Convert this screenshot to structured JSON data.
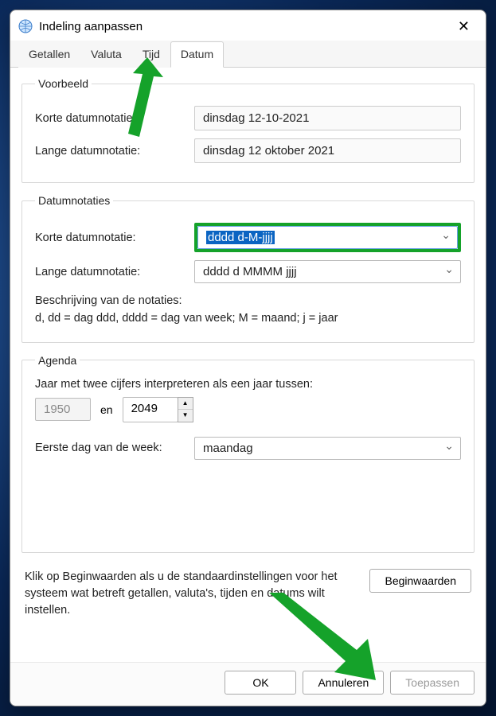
{
  "window": {
    "title": "Indeling aanpassen"
  },
  "tabs": {
    "items": [
      "Getallen",
      "Valuta",
      "Tijd",
      "Datum"
    ],
    "active_index": 3
  },
  "preview": {
    "legend": "Voorbeeld",
    "short_label": "Korte datumnotatie:",
    "short_value": "dinsdag 12-10-2021",
    "long_label": "Lange datumnotatie:",
    "long_value": "dinsdag 12 oktober 2021"
  },
  "formats": {
    "legend": "Datumnotaties",
    "short_label": "Korte datumnotatie:",
    "short_value": "dddd d-M-jjjj",
    "long_label": "Lange datumnotatie:",
    "long_value": "dddd d MMMM jjjj",
    "desc_line1": "Beschrijving van de notaties:",
    "desc_line2": "d, dd = dag   ddd, dddd = dag van week;   M = maand;   j = jaar"
  },
  "agenda": {
    "legend": "Agenda",
    "interpret_label": "Jaar met twee cijfers interpreteren als een jaar tussen:",
    "year_from": "1950",
    "and_label": "en",
    "year_to": "2049",
    "first_day_label": "Eerste dag van de week:",
    "first_day_value": "maandag"
  },
  "reset": {
    "text": "Klik op Beginwaarden als u de standaardinstellingen voor het systeem wat betreft getallen, valuta's, tijden en datums wilt instellen.",
    "button": "Beginwaarden"
  },
  "buttons": {
    "ok": "OK",
    "cancel": "Annuleren",
    "apply": "Toepassen"
  }
}
